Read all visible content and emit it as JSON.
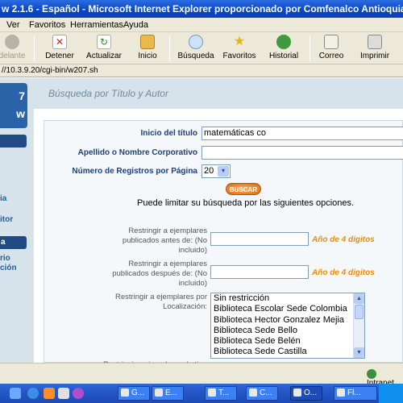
{
  "window": {
    "title": "w 2.1.6 - Español - Microsoft Internet Explorer proporcionado por Comfenalco Antioquia"
  },
  "menu": {
    "items": [
      "Ver",
      "Favoritos",
      "Herramientas",
      "Ayuda"
    ]
  },
  "toolbar": {
    "buttons": [
      {
        "label": "delante",
        "icon": "forward-arrow-icon",
        "disabled": true
      },
      {
        "label": "Detener",
        "icon": "stop-icon"
      },
      {
        "label": "Actualizar",
        "icon": "refresh-icon"
      },
      {
        "label": "Inicio",
        "icon": "home-icon"
      },
      {
        "label": "Búsqueda",
        "icon": "search-icon"
      },
      {
        "label": "Favoritos",
        "icon": "star-icon"
      },
      {
        "label": "Historial",
        "icon": "history-icon"
      },
      {
        "label": "Correo",
        "icon": "mail-icon"
      },
      {
        "label": "Imprimir",
        "icon": "printer-icon"
      }
    ]
  },
  "address": {
    "url": "//10.3.9.20/cgi-bin/w207.sh"
  },
  "sidebar": {
    "logo_top": "7",
    "logo_bottom": "w",
    "links": [
      "ia",
      "itor",
      "rio",
      "ción"
    ],
    "heading": "a"
  },
  "page": {
    "title": "Búsqueda por Título y Autor"
  },
  "form": {
    "title_label": "Inicio del título",
    "title_value": "matemáticas co",
    "author_label": "Apellido o Nombre Corporativo",
    "author_value": "",
    "records_label": "Número de Registros por Página",
    "records_value": "20",
    "search_button": "BUSCAR",
    "hint": "Puede limitar su búsqueda por las siguientes opciones.",
    "before_label": "Restringir a ejemplares publicados antes de: (No incluido)",
    "before_hint": "Año de 4 digitos",
    "after_label": "Restringir a ejemplares publicados después de: (No incluido)",
    "after_hint": "Año de 4 digitos",
    "location_label": "Restringir a ejemplares por Localización:",
    "locations": [
      "Sin restricción",
      "Biblioteca Escolar Sede Colombia",
      "Biblioteca Hector Gonzalez Mejia",
      "Biblioteca Sede Bello",
      "Biblioteca Sede Belén",
      "Biblioteca Sede Castilla"
    ],
    "next_label": "Restringir a ejemplares de tipo"
  },
  "status": {
    "zone": "Intranet"
  },
  "taskbar": {
    "tasks": [
      {
        "label": "G..."
      },
      {
        "label": "E..."
      },
      {
        "label": "T..."
      },
      {
        "label": "C..."
      },
      {
        "label": "O..."
      },
      {
        "label": "Fl..."
      }
    ]
  }
}
